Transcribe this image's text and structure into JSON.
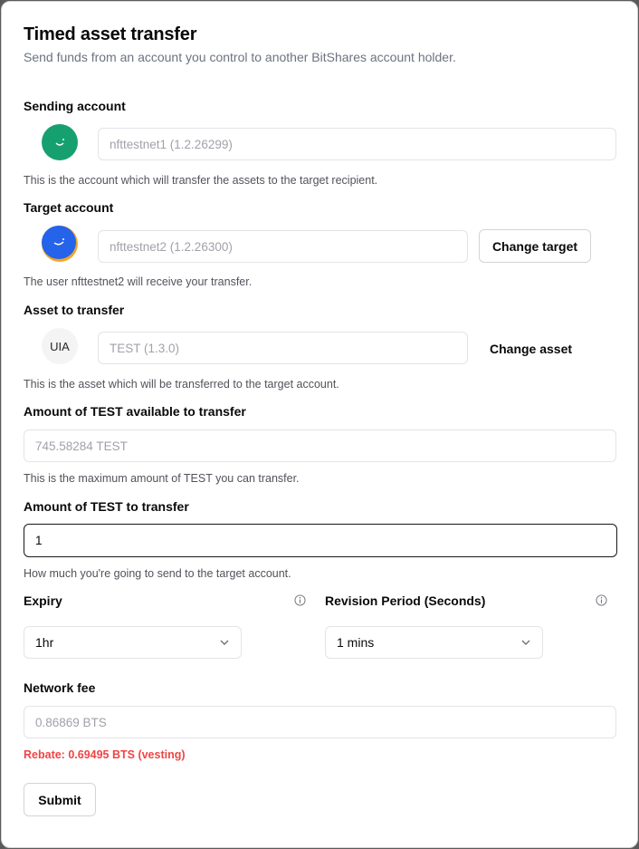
{
  "header": {
    "title": "Timed asset transfer",
    "subtitle": "Send funds from an account you control to another BitShares account holder."
  },
  "sending": {
    "label": "Sending account",
    "value": "nfttestnet1 (1.2.26299)",
    "help": "This is the account which will transfer the assets to the target recipient.",
    "avatar_color": "#16a070"
  },
  "target": {
    "label": "Target account",
    "value": "nfttestnet2 (1.2.26300)",
    "button": "Change target",
    "help": "The user nfttestnet2 will receive your transfer.",
    "avatar_color": "#2563eb",
    "avatar_accent": "#f5a623"
  },
  "asset": {
    "label": "Asset to transfer",
    "badge": "UIA",
    "value": "TEST (1.3.0)",
    "button": "Change asset",
    "help": "This is the asset which will be transferred to the target account."
  },
  "available": {
    "label": "Amount of TEST available to transfer",
    "value": "745.58284 TEST",
    "help": "This is the maximum amount of TEST you can transfer."
  },
  "amount": {
    "label": "Amount of TEST to transfer",
    "value": "1",
    "help": "How much you're going to send to the target account."
  },
  "expiry": {
    "label": "Expiry",
    "selected": "1hr"
  },
  "revision": {
    "label": "Revision Period (Seconds)",
    "selected": "1 mins"
  },
  "fee": {
    "label": "Network fee",
    "value": "0.86869 BTS",
    "rebate": "Rebate: 0.69495 BTS (vesting)"
  },
  "submit_label": "Submit",
  "colors": {
    "error": "#ef4444",
    "border": "#e4e4e7"
  }
}
